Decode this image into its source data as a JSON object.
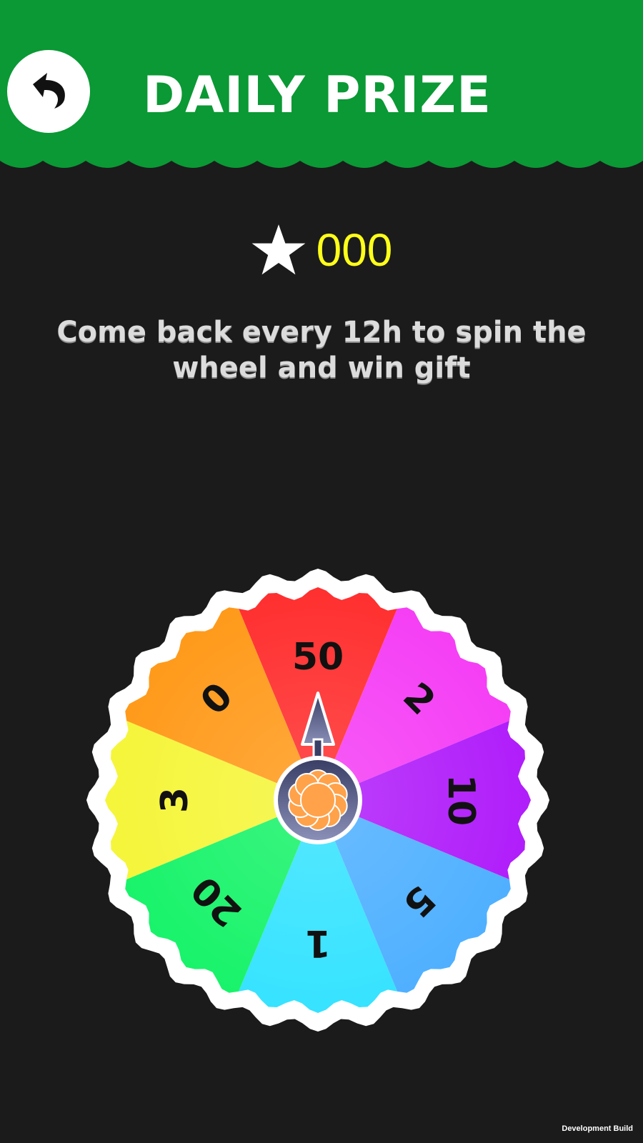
{
  "header": {
    "title": "DAILY PRIZE",
    "back_icon": "back-arrow-icon",
    "bg_color": "#0a9934"
  },
  "score": {
    "icon": "star-icon",
    "value": "000",
    "value_color": "#ffff1a"
  },
  "message": "Come back every 12h to spin the wheel and win gift",
  "wheel": {
    "segments": [
      {
        "label": "50",
        "color": "#ff2f2f"
      },
      {
        "label": "2",
        "color": "#f53ef5"
      },
      {
        "label": "10",
        "color": "#b01dfa"
      },
      {
        "label": "5",
        "color": "#4fb0ff"
      },
      {
        "label": "1",
        "color": "#36e3ff"
      },
      {
        "label": "20",
        "color": "#18f36a"
      },
      {
        "label": "3",
        "color": "#f5f53a"
      },
      {
        "label": "0",
        "color": "#ff9a1a"
      }
    ],
    "pointer_icon": "spin-pointer-icon",
    "hub_icon": "flower-hub-icon"
  },
  "footer": {
    "build_label": "Development Build"
  }
}
